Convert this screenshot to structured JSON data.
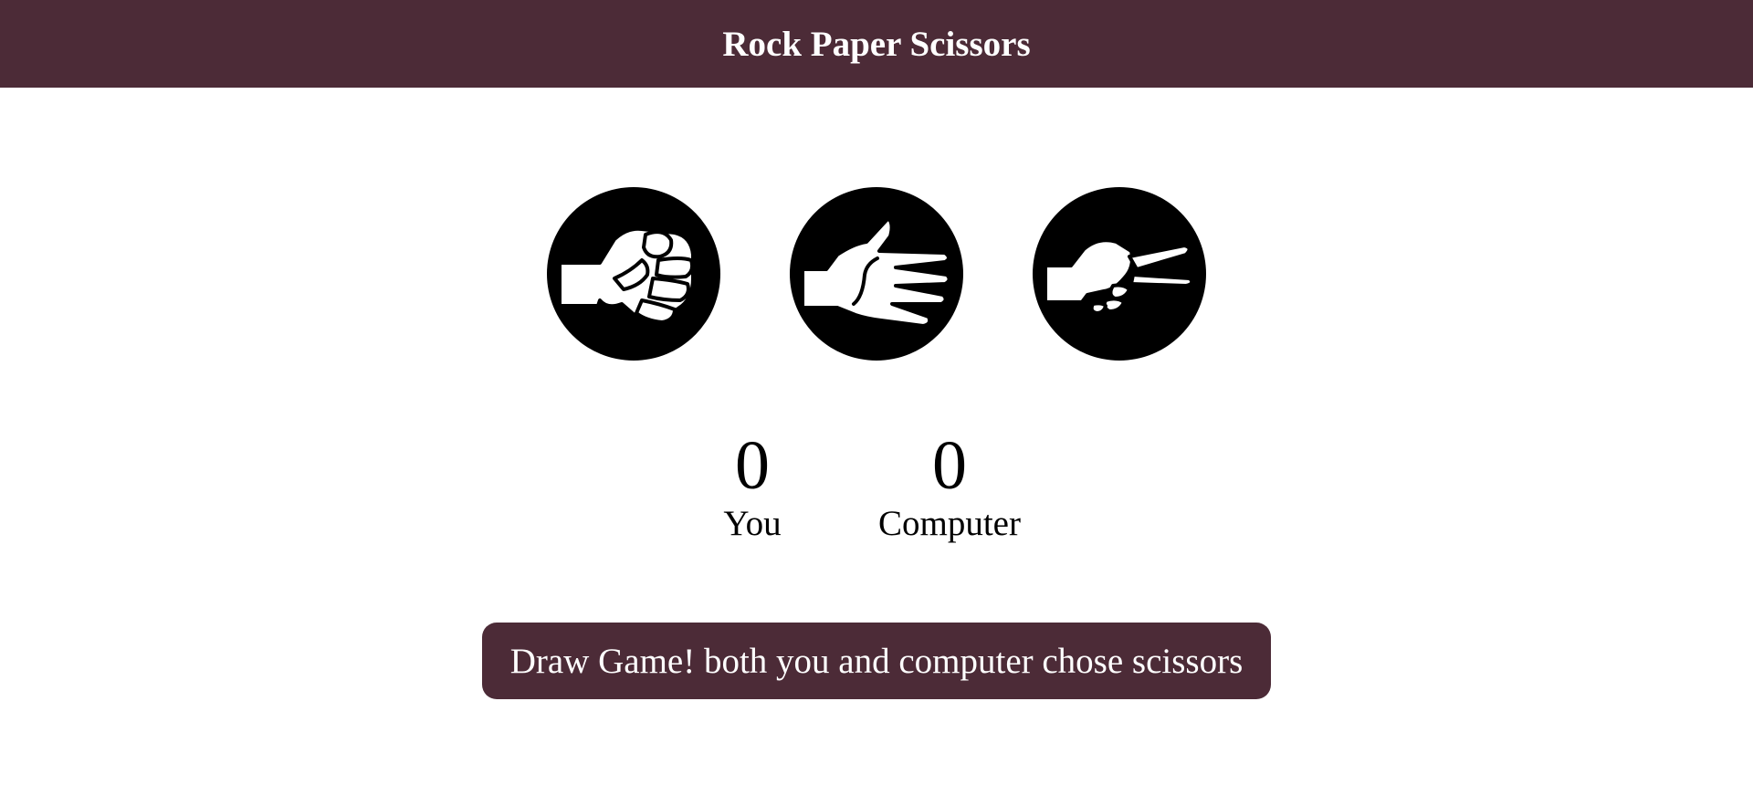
{
  "header": {
    "title": "Rock Paper Scissors"
  },
  "colors": {
    "brand": "#4c2b37",
    "choice_bg": "#000000",
    "hand_fill": "#ffffff",
    "text_on_brand": "#ffffff"
  },
  "choices": [
    {
      "id": "rock",
      "icon": "fist-icon"
    },
    {
      "id": "paper",
      "icon": "open-hand-icon"
    },
    {
      "id": "scissors",
      "icon": "victory-hand-icon"
    }
  ],
  "scoreboard": {
    "you": {
      "score": "0",
      "label": "You"
    },
    "computer": {
      "score": "0",
      "label": "Computer"
    }
  },
  "result": {
    "message": "Draw Game! both you and computer chose scissors"
  }
}
